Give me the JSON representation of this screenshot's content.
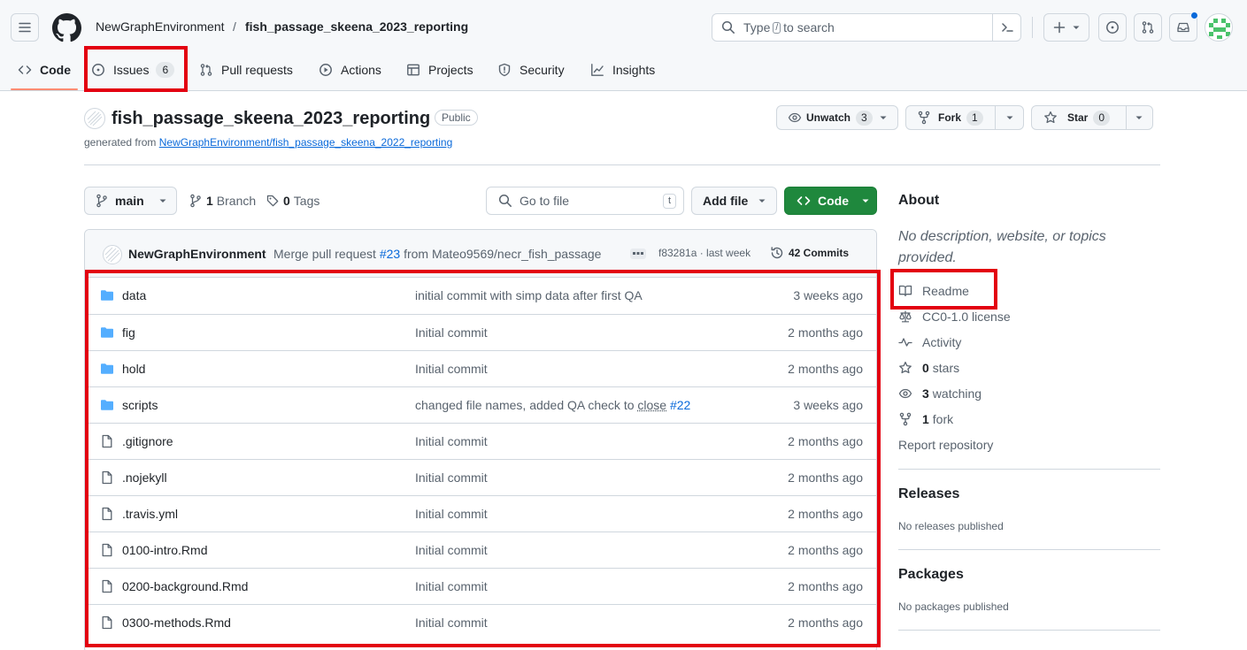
{
  "header": {
    "owner": "NewGraphEnvironment",
    "separator": "/",
    "repo": "fish_passage_skeena_2023_reporting",
    "search_prefix": "Type",
    "search_key": "/",
    "search_suffix": "to search"
  },
  "tabs": [
    {
      "label": "Code",
      "icon": "code-icon"
    },
    {
      "label": "Issues",
      "icon": "issue-icon",
      "count": "6"
    },
    {
      "label": "Pull requests",
      "icon": "pull-request-icon"
    },
    {
      "label": "Actions",
      "icon": "play-icon"
    },
    {
      "label": "Projects",
      "icon": "table-icon"
    },
    {
      "label": "Security",
      "icon": "shield-icon"
    },
    {
      "label": "Insights",
      "icon": "graph-icon"
    }
  ],
  "repo": {
    "name": "fish_passage_skeena_2023_reporting",
    "visibility": "Public",
    "generated_prefix": "generated from",
    "generated_link": "NewGraphEnvironment/fish_passage_skeena_2022_reporting",
    "unwatch_label": "Unwatch",
    "watch_count": "3",
    "fork_label": "Fork",
    "fork_count": "1",
    "star_label": "Star",
    "star_count": "0"
  },
  "toolbar": {
    "branch": "main",
    "branches_count": "1",
    "branches_label": "Branch",
    "tags_count": "0",
    "tags_label": "Tags",
    "goto_placeholder": "Go to file",
    "goto_key": "t",
    "add_file": "Add file",
    "code": "Code"
  },
  "commit": {
    "author": "NewGraphEnvironment",
    "message_prefix": "Merge pull request",
    "pr": "#23",
    "message_suffix": "from Mateo9569/necr_fish_passage",
    "sha_time": "f83281a · last week",
    "commits": "42 Commits"
  },
  "files": [
    {
      "type": "folder",
      "name": "data",
      "message": "initial commit with simp data after first QA",
      "date": "3 weeks ago"
    },
    {
      "type": "folder",
      "name": "fig",
      "message": "Initial commit",
      "date": "2 months ago"
    },
    {
      "type": "folder",
      "name": "hold",
      "message": "Initial commit",
      "date": "2 months ago"
    },
    {
      "type": "folder",
      "name": "scripts",
      "message": "changed file names, added QA check to",
      "message_close": "close",
      "message_issue": "#22",
      "date": "3 weeks ago"
    },
    {
      "type": "file",
      "name": ".gitignore",
      "message": "Initial commit",
      "date": "2 months ago"
    },
    {
      "type": "file",
      "name": ".nojekyll",
      "message": "Initial commit",
      "date": "2 months ago"
    },
    {
      "type": "file",
      "name": ".travis.yml",
      "message": "Initial commit",
      "date": "2 months ago"
    },
    {
      "type": "file",
      "name": "0100-intro.Rmd",
      "message": "Initial commit",
      "date": "2 months ago"
    },
    {
      "type": "file",
      "name": "0200-background.Rmd",
      "message": "Initial commit",
      "date": "2 months ago"
    },
    {
      "type": "file",
      "name": "0300-methods.Rmd",
      "message": "Initial commit",
      "date": "2 months ago"
    }
  ],
  "about": {
    "heading": "About",
    "description": "No description, website, or topics provided.",
    "readme": "Readme",
    "license": "CC0-1.0 license",
    "activity": "Activity",
    "stars_count": "0",
    "stars_label": "stars",
    "watching_count": "3",
    "watching_label": "watching",
    "fork_count": "1",
    "fork_label": "fork",
    "report": "Report repository"
  },
  "releases": {
    "heading": "Releases",
    "text": "No releases published"
  },
  "packages": {
    "heading": "Packages",
    "text": "No packages published"
  },
  "colors": {
    "accent": "#0969da",
    "code_button": "#1f883d",
    "highlight": "#e3000f",
    "tab_underline": "#fd8c73"
  }
}
